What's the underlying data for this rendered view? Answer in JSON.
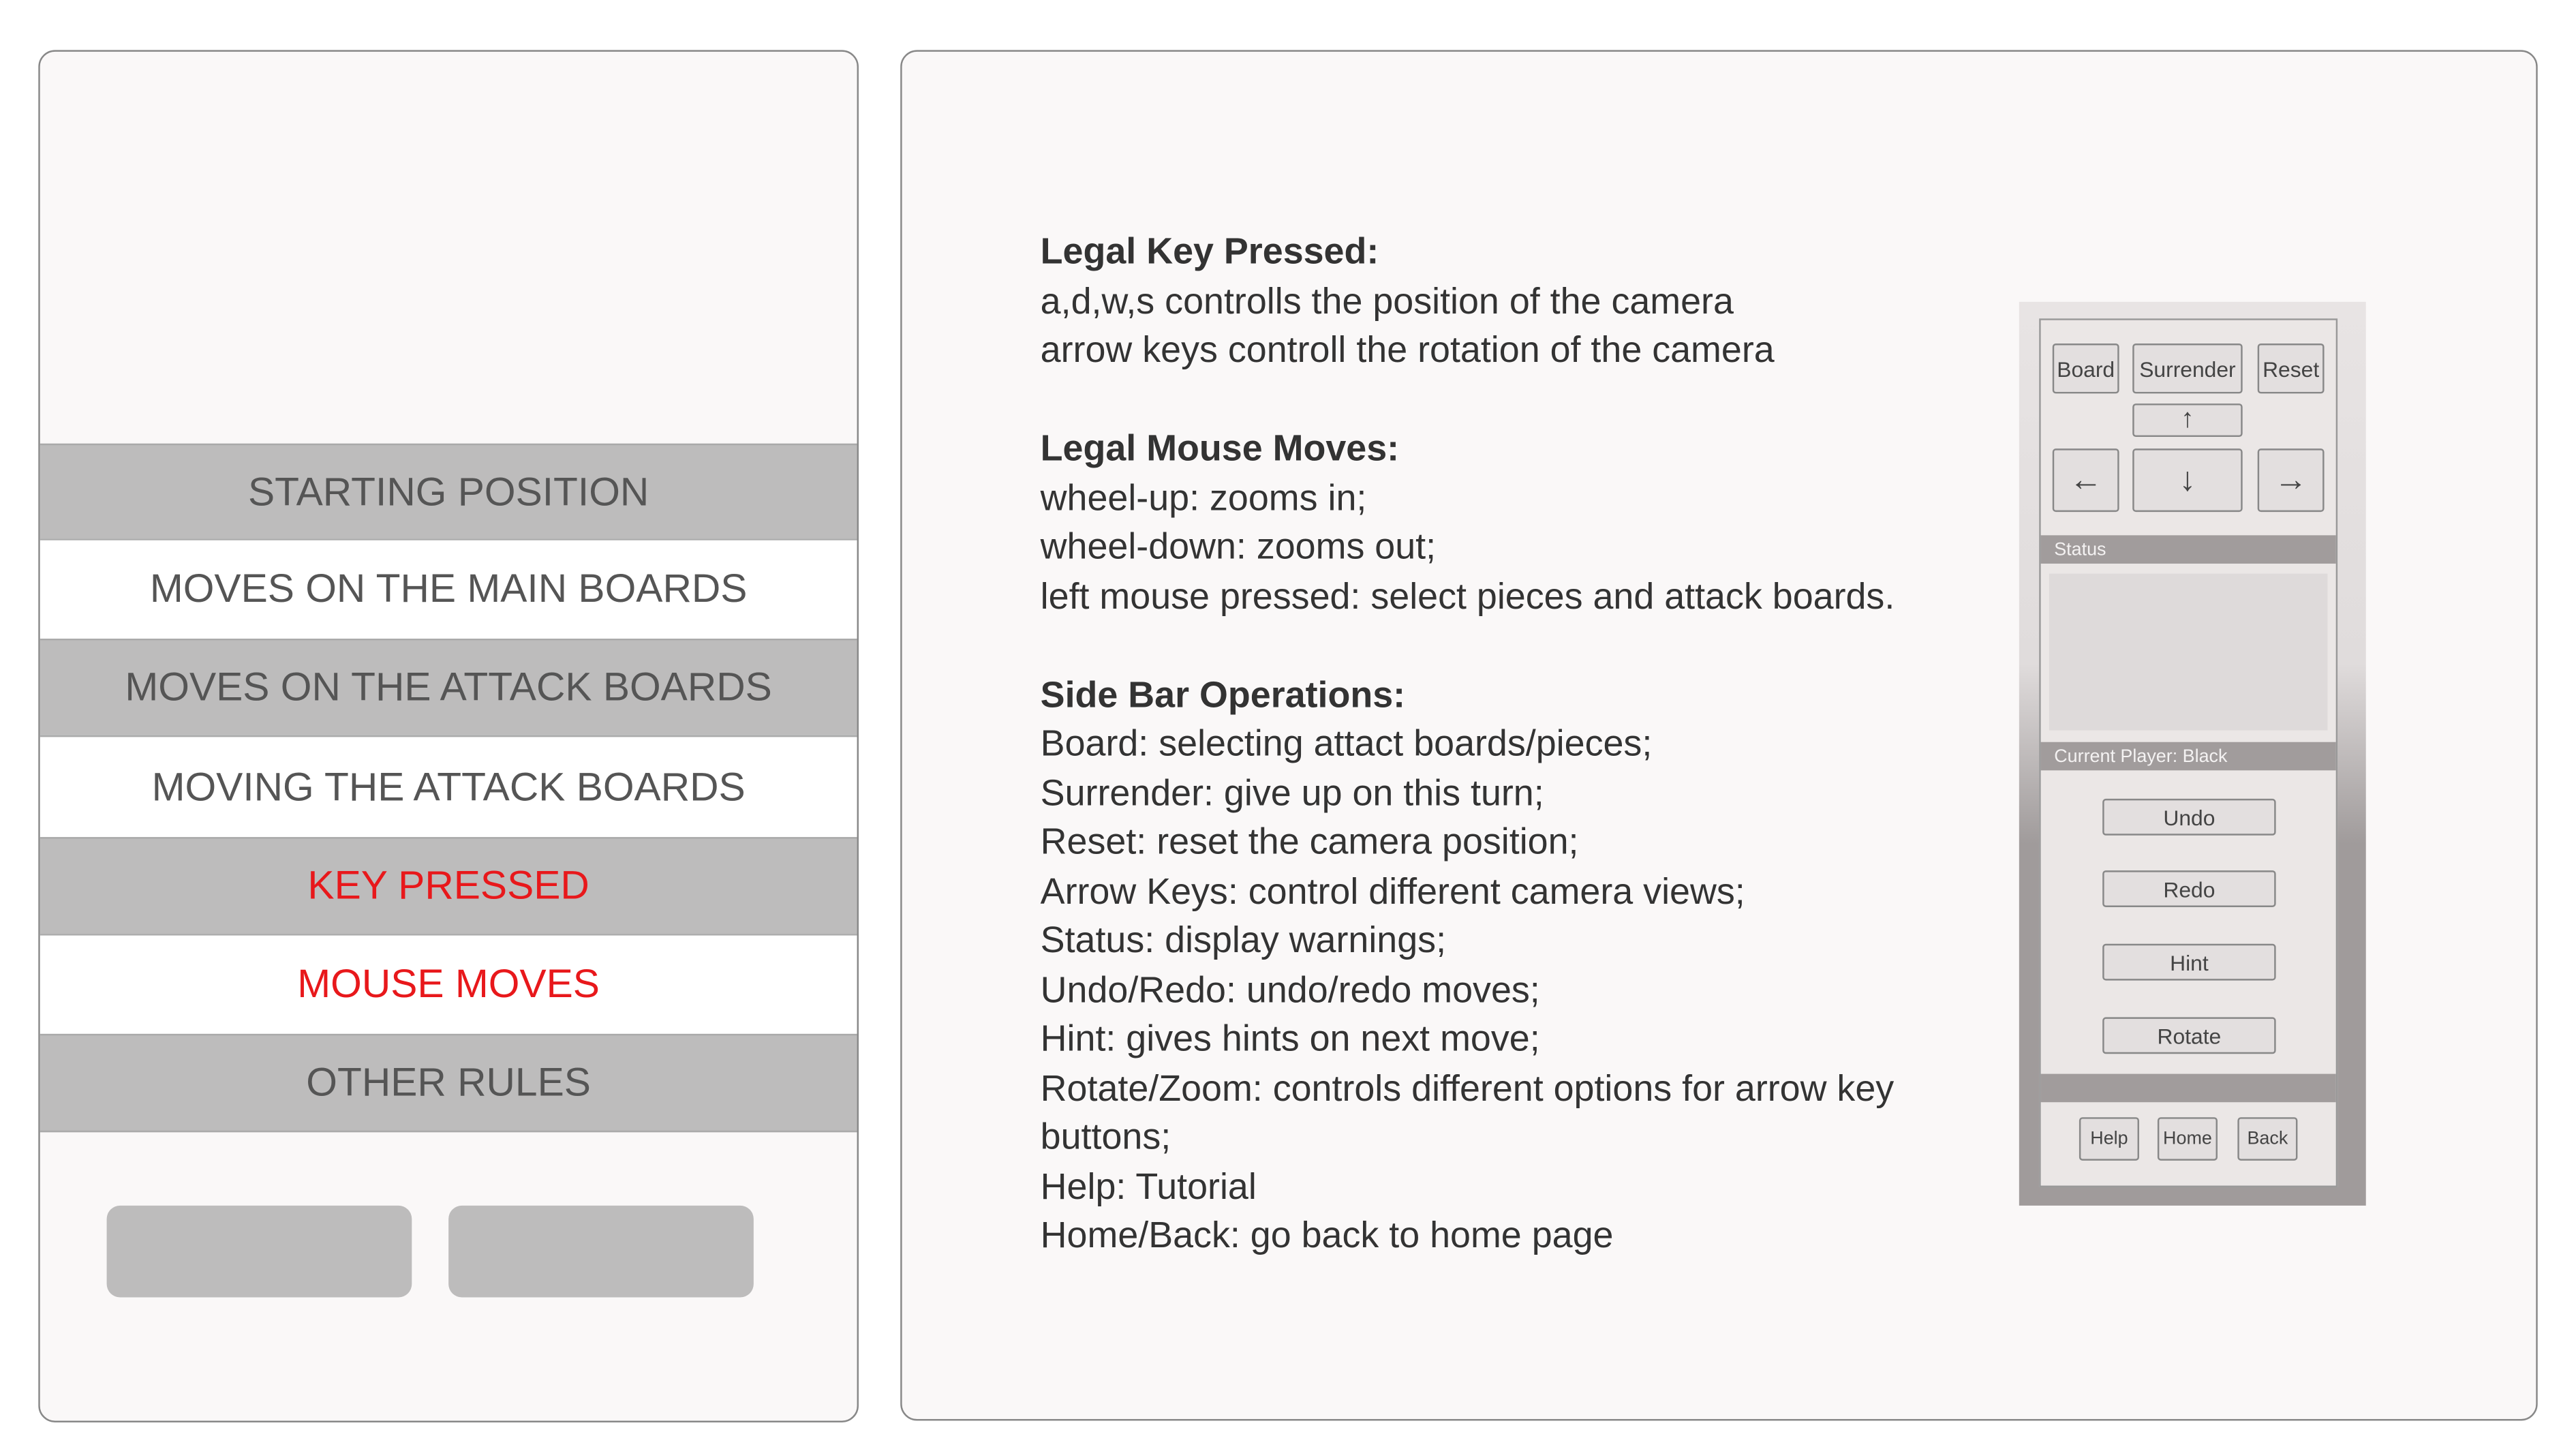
{
  "menu": {
    "items": [
      {
        "label": "STARTING POSITION",
        "active": false
      },
      {
        "label": "MOVES ON THE MAIN BOARDS",
        "active": false
      },
      {
        "label": "MOVES ON THE ATTACK BOARDS",
        "active": false
      },
      {
        "label": "MOVING THE ATTACK BOARDS",
        "active": false
      },
      {
        "label": "KEY PRESSED",
        "active": true
      },
      {
        "label": "MOUSE MOVES",
        "active": true
      },
      {
        "label": "OTHER RULES",
        "active": false
      }
    ],
    "active_color": "#e8181b"
  },
  "help": {
    "keys_heading": "Legal Key Pressed:",
    "keys": [
      "a,d,w,s controlls the position of the camera",
      "arrow keys controll the rotation of the camera"
    ],
    "mouse_heading": "Legal Mouse Moves:",
    "mouse": [
      "wheel-up: zooms in;",
      "wheel-down: zooms out;",
      "left mouse pressed: select pieces and attack boards."
    ],
    "sidebar_heading": "Side Bar Operations:",
    "sidebar": [
      "Board: selecting attact boards/pieces;",
      "Surrender: give up on this turn;",
      "Reset: reset the camera position;",
      "Arrow Keys: control different camera views;",
      "Status: display warnings;",
      "Undo/Redo: undo/redo moves;",
      "Hint: gives hints on next move;",
      "Rotate/Zoom: controls different options for arrow key buttons;",
      "Help: Tutorial",
      "Home/Back: go back to home page"
    ]
  },
  "mock": {
    "board": "Board",
    "surrender": "Surrender",
    "reset": "Reset",
    "up": "↑",
    "left": "←",
    "down": "↓",
    "right": "→",
    "status_label": "Status",
    "player_label": "Current Player: Black",
    "undo": "Undo",
    "redo": "Redo",
    "hint": "Hint",
    "rotate": "Rotate",
    "help": "Help",
    "home": "Home",
    "back": "Back"
  }
}
